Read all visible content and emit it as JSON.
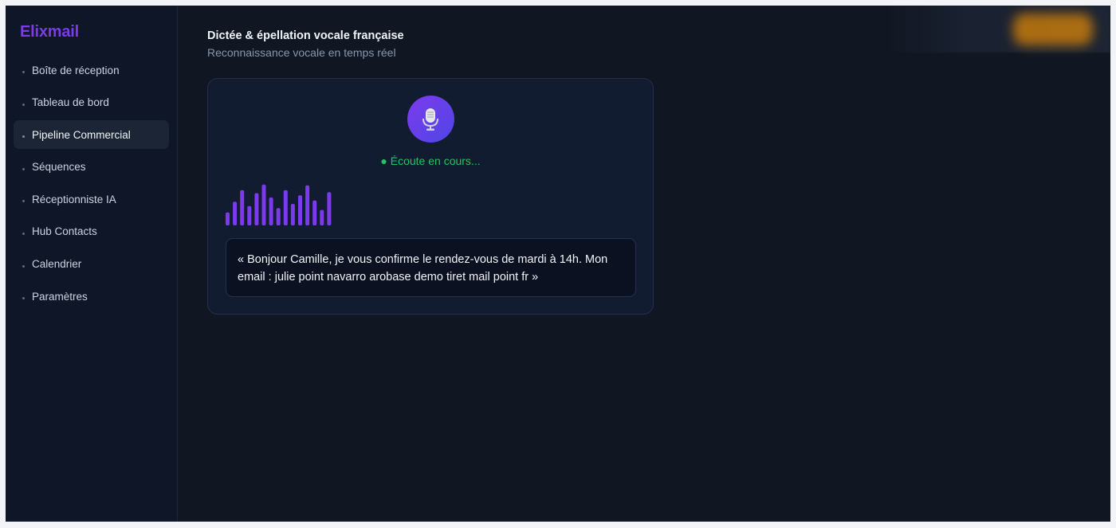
{
  "app": {
    "name": "Elixmail"
  },
  "sidebar": {
    "items": [
      {
        "label": "Boîte de réception",
        "active": false
      },
      {
        "label": "Tableau de bord",
        "active": false
      },
      {
        "label": "Pipeline Commercial",
        "active": true
      },
      {
        "label": "Séquences",
        "active": false
      },
      {
        "label": "Réceptionniste IA",
        "active": false
      },
      {
        "label": "Hub Contacts",
        "active": false
      },
      {
        "label": "Calendrier",
        "active": false
      },
      {
        "label": "Paramètres",
        "active": false
      }
    ]
  },
  "main": {
    "title": "Dictée & épellation vocale française",
    "subtitle": "Reconnaissance vocale en temps réel"
  },
  "dictation": {
    "mic_icon": "microphone-icon",
    "status": "● Écoute en cours...",
    "waveform_levels": [
      0.3,
      0.55,
      0.82,
      0.45,
      0.75,
      0.95,
      0.65,
      0.4,
      0.82,
      0.5,
      0.7,
      0.93,
      0.58,
      0.36,
      0.77
    ],
    "transcript": "« Bonjour Camille, je vous confirme le rendez-vous de mardi à 14h. Mon email : julie point navarro arobase demo tiret mail point fr »"
  },
  "colors": {
    "accent": "#7c3aed",
    "status_green": "#22c55e",
    "background": "#111722",
    "sidebar": "#0e1628"
  }
}
